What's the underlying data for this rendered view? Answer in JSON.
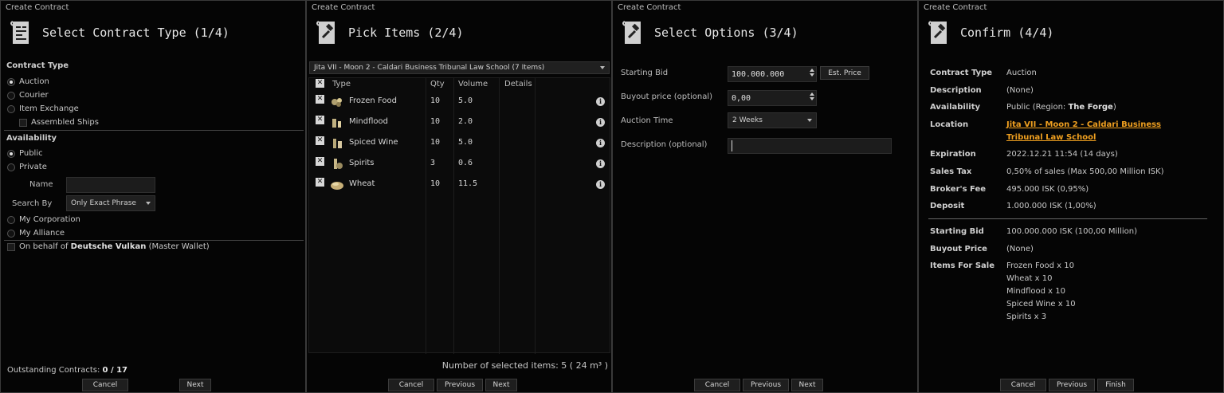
{
  "window_title": "Create Contract",
  "p1": {
    "header": "Select Contract Type (1/4)",
    "contract_type_label": "Contract Type",
    "types": [
      "Auction",
      "Courier",
      "Item Exchange"
    ],
    "selected_type": "Auction",
    "assembled_ships": "Assembled Ships",
    "availability_label": "Availability",
    "public": "Public",
    "private": "Private",
    "name_label": "Name",
    "search_by_label": "Search By",
    "search_by_value": "Only Exact Phrase",
    "my_corporation": "My Corporation",
    "my_alliance": "My Alliance",
    "on_behalf_prefix": "On behalf of",
    "on_behalf_name": "Deutsche Vulkan",
    "on_behalf_suffix": "(Master Wallet)",
    "outstanding_label": "Outstanding Contracts:",
    "outstanding_value": "0 / 17",
    "cancel": "Cancel",
    "next": "Next"
  },
  "p2": {
    "header": "Pick Items (2/4)",
    "location": "Jita VII - Moon 2 - Caldari Business Tribunal Law School (7 Items)",
    "columns": [
      "Type",
      "Qty",
      "Volume",
      "Details"
    ],
    "items": [
      {
        "name": "Frozen Food",
        "qty": "10",
        "volume": "5.0"
      },
      {
        "name": "Mindflood",
        "qty": "10",
        "volume": "2.0"
      },
      {
        "name": "Spiced Wine",
        "qty": "10",
        "volume": "5.0"
      },
      {
        "name": "Spirits",
        "qty": "3",
        "volume": "0.6"
      },
      {
        "name": "Wheat",
        "qty": "10",
        "volume": "11.5"
      }
    ],
    "selected_summary": "Number of selected items: 5 ( 24 m³ )",
    "cancel": "Cancel",
    "previous": "Previous",
    "next": "Next"
  },
  "p3": {
    "header": "Select Options (3/4)",
    "starting_bid_label": "Starting Bid",
    "starting_bid_value": "100.000.000",
    "est_price": "Est. Price",
    "buyout_label": "Buyout price (optional)",
    "buyout_value": "0,00",
    "auction_time_label": "Auction Time",
    "auction_time_value": "2 Weeks",
    "description_label": "Description (optional)",
    "cancel": "Cancel",
    "previous": "Previous",
    "next": "Next"
  },
  "p4": {
    "header": "Confirm (4/4)",
    "rows": [
      {
        "k": "Contract Type",
        "v": "Auction"
      },
      {
        "k": "Description",
        "v": "(None)"
      },
      {
        "k": "Availability",
        "v": "Public (Region: ",
        "v_bold": "The Forge",
        "v_end": ")"
      },
      {
        "k": "Location",
        "v_link1": "Jita VII - Moon 2 - Caldari Business",
        "v_link2": "Tribunal Law School"
      },
      {
        "k": "Expiration",
        "v": "2022.12.21 11:54 (14 days)"
      },
      {
        "k": "Sales Tax",
        "v": "0,50% of sales (Max 500,00 Million ISK)"
      },
      {
        "k": "Broker's Fee",
        "v": "495.000 ISK (0,95%)"
      },
      {
        "k": "Deposit",
        "v": "1.000.000 ISK (1,00%)"
      }
    ],
    "rows2": [
      {
        "k": "Starting Bid",
        "v": "100.000.000 ISK (100,00 Million)"
      },
      {
        "k": "Buyout Price",
        "v": "(None)"
      },
      {
        "k": "Items For Sale",
        "v": [
          "Frozen Food x 10",
          "Wheat x 10",
          "Mindflood x 10",
          "Spiced Wine x 10",
          "Spirits x 3"
        ]
      }
    ],
    "cancel": "Cancel",
    "previous": "Previous",
    "finish": "Finish"
  }
}
